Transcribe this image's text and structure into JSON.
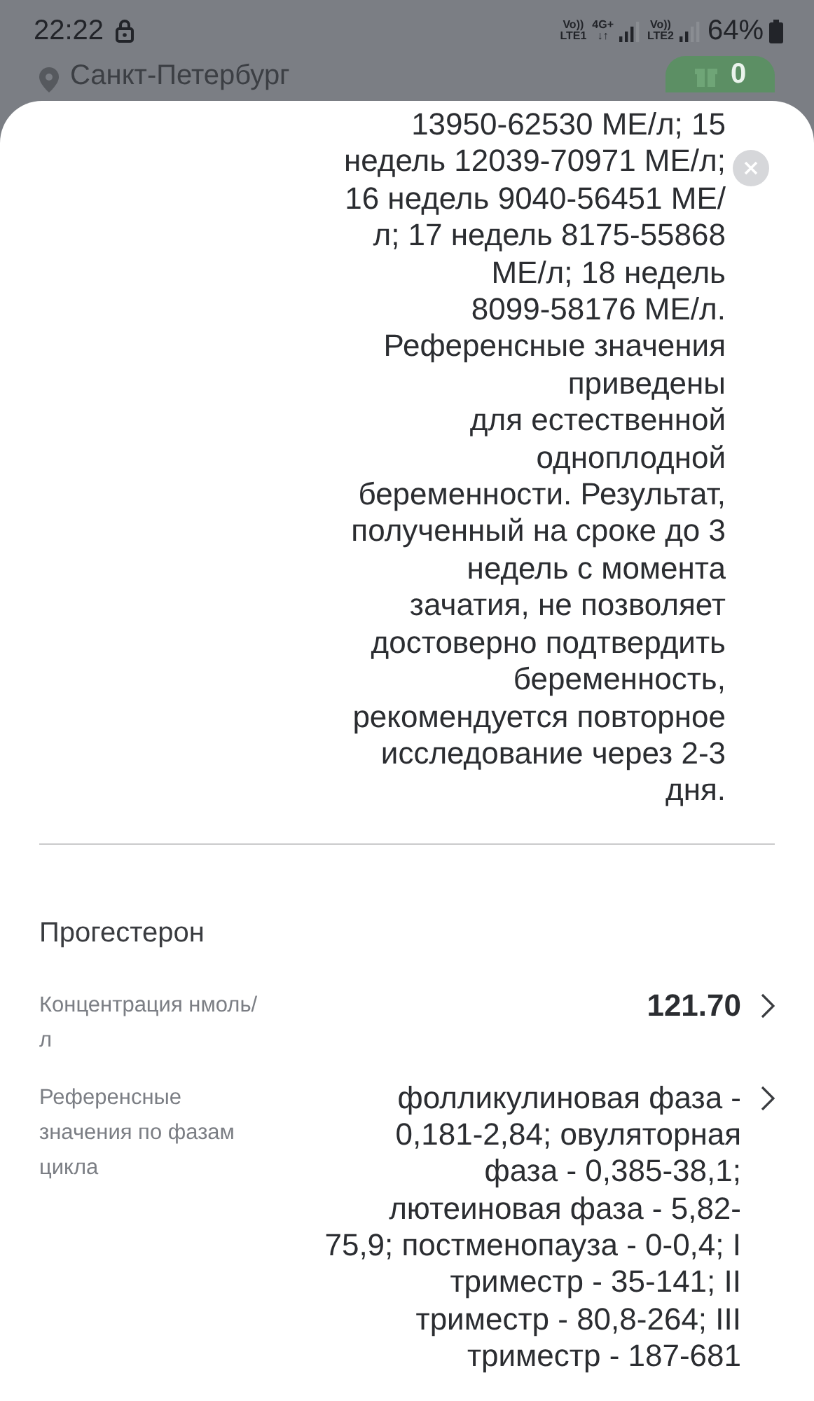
{
  "status_bar": {
    "time": "22:22",
    "sim1": "Vo)) LTE1",
    "network": "4G+",
    "network_arrows": "↓↑",
    "sim2": "Vo)) LTE2",
    "battery": "64%"
  },
  "header": {
    "city": "Санкт-Петербург",
    "bonus": "0"
  },
  "sheet": {
    "note_lines": [
      "13950-62530 МЕ/л; 15",
      "недель 12039-70971 МЕ/л;",
      "16 недель 9040-56451 МЕ/",
      "л; 17 недель 8175-55868",
      "МЕ/л; 18 недель",
      "8099-58176 МЕ/л.",
      "Референсные значения",
      "приведены",
      "для естественной",
      "одноплодной",
      "беременности. Результат,",
      "полученный на сроке до 3",
      "недель с момента",
      "зачатия, не позволяет",
      "достоверно подтвердить",
      "беременность,",
      "рекомендуется повторное",
      "исследование через 2-3",
      "дня."
    ],
    "section_title": "Прогестерон",
    "rows": [
      {
        "label": "Концентрация нмоль/л",
        "value": "121.70",
        "kind": "number"
      },
      {
        "label": "Референсные значения по фазам цикла",
        "value": "фолликулиновая фаза - 0,181-2,84; овуляторная фаза - 0,385-38,1; лютеиновая фаза - 5,82-75,9; постменопауза - 0-0,4; I триместр - 35-141; II триместр - 80,8-264; III триместр - 187-681",
        "kind": "text"
      }
    ]
  }
}
